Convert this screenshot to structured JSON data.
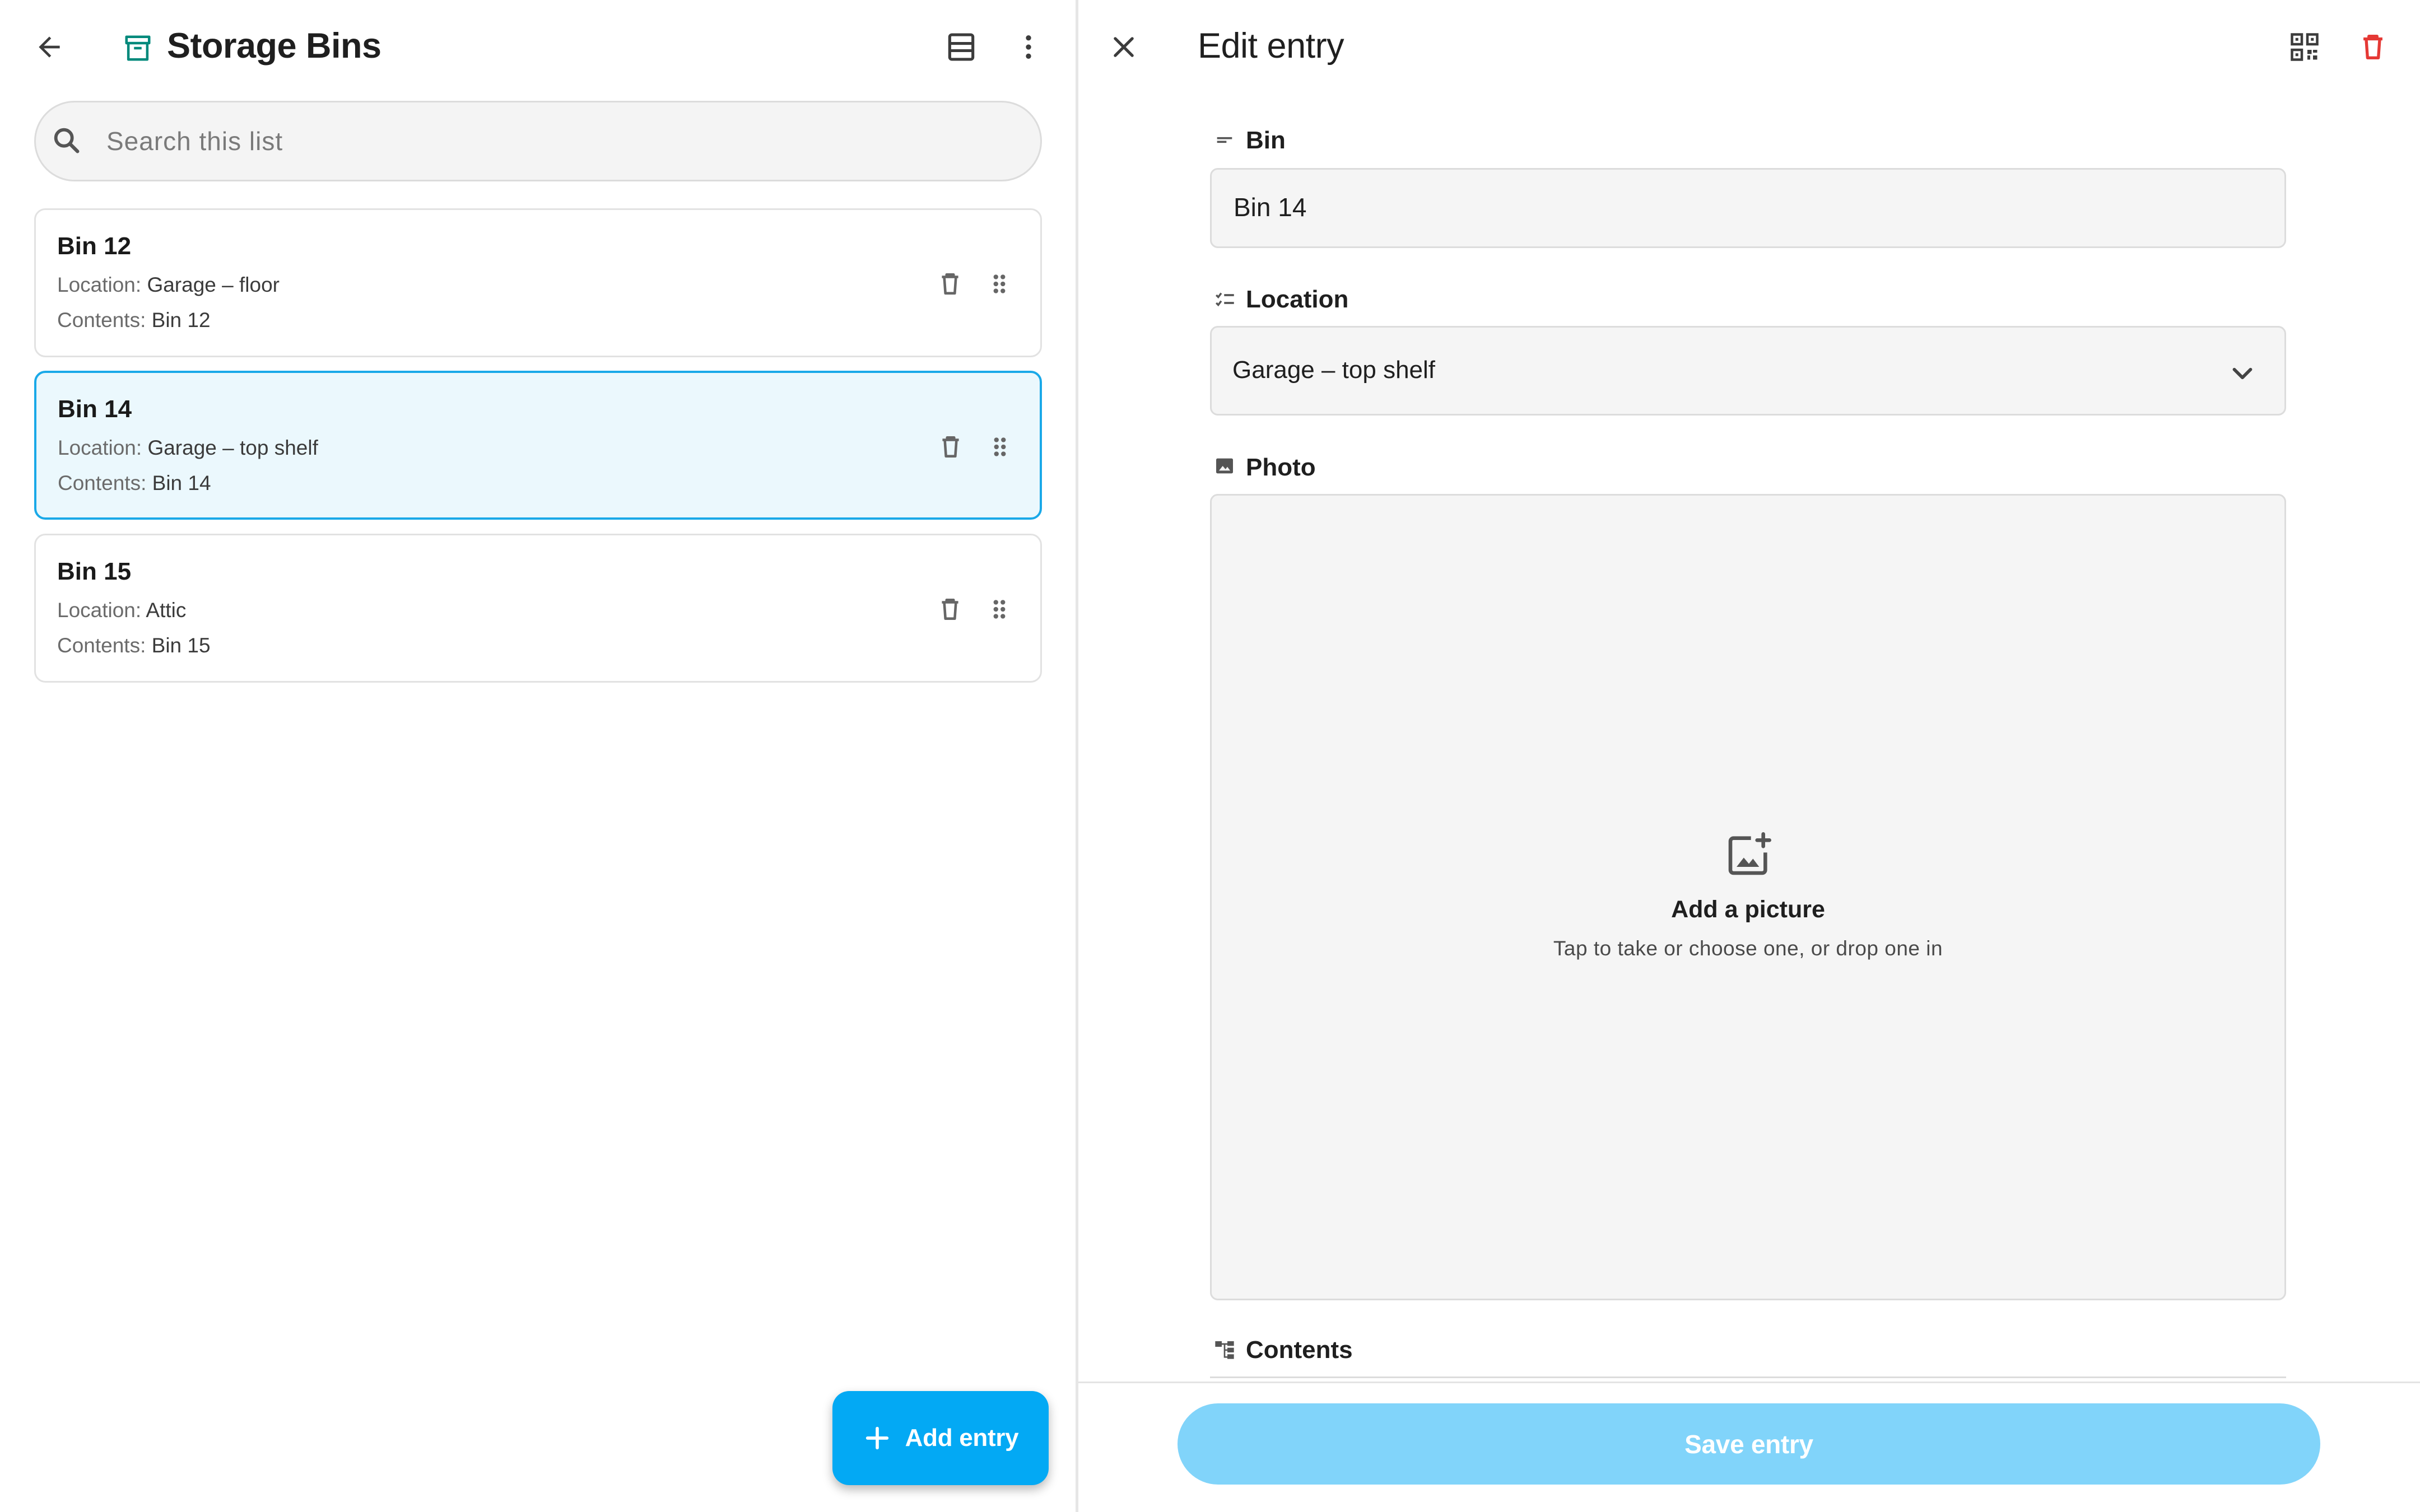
{
  "list_header": {
    "title": "Storage Bins",
    "back_icon": "arrow-left-icon",
    "list_icon": "archive-box-icon",
    "view_icon": "view-agenda-icon",
    "menu_icon": "more-vert-icon"
  },
  "search": {
    "placeholder": "Search this list",
    "value": "",
    "icon": "search-icon"
  },
  "entries": [
    {
      "title": "Bin 12",
      "location_label": "Location:",
      "location": "Garage – floor",
      "contents_label": "Contents:",
      "contents": "Bin 12",
      "selected": false
    },
    {
      "title": "Bin 14",
      "location_label": "Location:",
      "location": "Garage – top shelf",
      "contents_label": "Contents:",
      "contents": "Bin 14",
      "selected": true
    },
    {
      "title": "Bin 15",
      "location_label": "Location:",
      "location": "Attic",
      "contents_label": "Contents:",
      "contents": "Bin 15",
      "selected": false
    }
  ],
  "fab": {
    "label": "Add entry",
    "icon": "plus-icon"
  },
  "editor": {
    "title": "Edit entry",
    "close_icon": "close-icon",
    "qr_icon": "qr-code-icon",
    "delete_icon": "trash-icon",
    "fields": {
      "bin": {
        "label": "Bin",
        "value": "Bin 14",
        "icon": "short-text-icon"
      },
      "location": {
        "label": "Location",
        "value": "Garage – top shelf",
        "icon": "checklist-icon"
      },
      "photo": {
        "label": "Photo",
        "title": "Add a picture",
        "subtitle": "Tap to take or choose one, or drop one in",
        "icon": "image-icon",
        "add_icon": "add-photo-icon"
      },
      "contents": {
        "label": "Contents",
        "icon": "account-tree-icon"
      }
    },
    "save_label": "Save entry"
  },
  "colors": {
    "accent": "#03a9f4",
    "accent_disabled": "#81d4fa",
    "selected_bg": "#ebf8fd",
    "selected_border": "#1aa9e8",
    "archive_icon": "#00897b",
    "delete_red": "#e53935"
  }
}
